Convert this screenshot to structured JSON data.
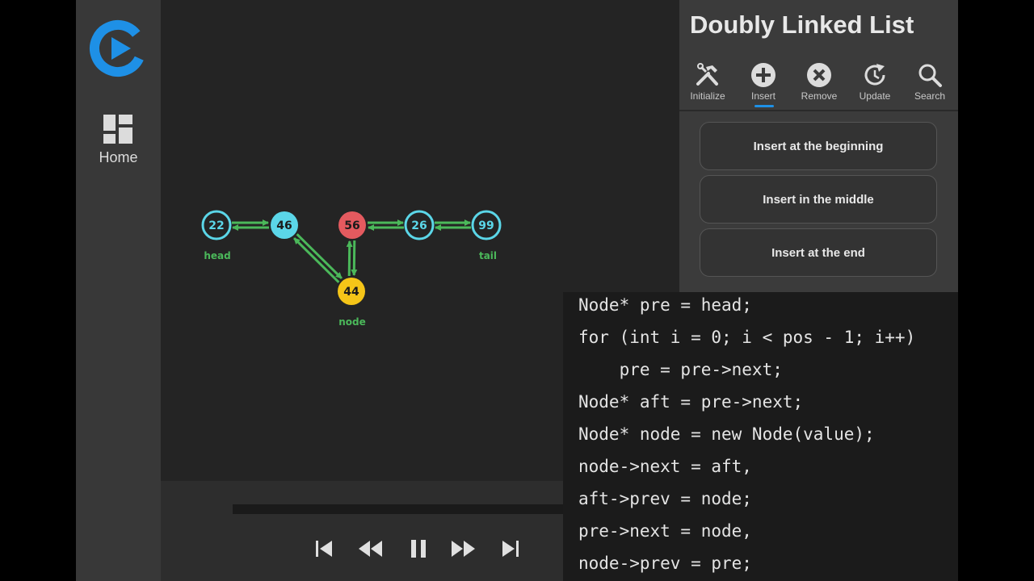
{
  "sidebar": {
    "home_label": "Home"
  },
  "list": {
    "nodes": [
      {
        "value": "22",
        "color": "#5bd6e8",
        "style": "ring"
      },
      {
        "value": "46",
        "color": "#5bd6e8",
        "style": "filled"
      },
      {
        "value": "56",
        "color": "#e45a5f",
        "style": "filled"
      },
      {
        "value": "26",
        "color": "#5bd6e8",
        "style": "ring"
      },
      {
        "value": "99",
        "color": "#5bd6e8",
        "style": "ring"
      },
      {
        "value": "44",
        "color": "#f5c518",
        "style": "filled"
      }
    ],
    "tags": {
      "head": "head",
      "tail": "tail",
      "node": "node"
    },
    "link_color": "#4bb85a"
  },
  "panel": {
    "title": "Doubly Linked List",
    "tabs": [
      {
        "label": "Initialize",
        "icon": "tools-icon"
      },
      {
        "label": "Insert",
        "icon": "plus-circle-icon",
        "active": true
      },
      {
        "label": "Remove",
        "icon": "x-circle-icon"
      },
      {
        "label": "Update",
        "icon": "update-icon"
      },
      {
        "label": "Search",
        "icon": "search-icon"
      }
    ],
    "options": [
      "Insert at the beginning",
      "Insert in the middle",
      "Insert at the end"
    ]
  },
  "code": [
    "Node* pre = head;",
    "for (int i = 0; i < pos - 1; i++)",
    "    pre = pre->next;",
    "Node* aft = pre->next;",
    "Node* node = new Node(value);",
    "node->next = aft,",
    "aft->prev = node;",
    "pre->next = node,",
    "node->prev = pre;"
  ],
  "colors": {
    "accent": "#1e90e6",
    "background": "#242424",
    "panel": "#3b3b3b"
  }
}
